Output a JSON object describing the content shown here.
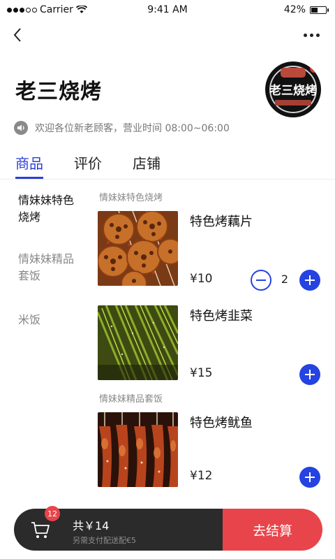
{
  "status_bar": {
    "carrier": "Carrier",
    "time": "9:41 AM",
    "battery": "42%",
    "battery_level": 0.42
  },
  "shop": {
    "name": "老三烧烤",
    "logo_text": "老三烧烤",
    "notice": "欢迎各位新老顾客，营业时间 08:00~06:00"
  },
  "tabs": [
    {
      "label": "商品",
      "active": true
    },
    {
      "label": "评价",
      "active": false
    },
    {
      "label": "店铺",
      "active": false
    }
  ],
  "categories": [
    {
      "label": "情妹妹特色烧烤",
      "active": true
    },
    {
      "label": "情妹妹精品套饭",
      "active": false
    },
    {
      "label": "米饭",
      "active": false
    }
  ],
  "sections": [
    {
      "title": "情妹妹特色烧烤"
    },
    {
      "title": "情妹妹精品套饭"
    }
  ],
  "products": [
    {
      "name": "特色烤藕片",
      "price": "¥10",
      "quantity": "2",
      "image": "grilled-lotus-root"
    },
    {
      "name": "特色烤韭菜",
      "price": "¥15",
      "quantity": "",
      "image": "grilled-chives"
    },
    {
      "name": "特色烤鱿鱼",
      "price": "¥12",
      "quantity": "",
      "image": "grilled-squid"
    }
  ],
  "cart": {
    "badge_count": "12",
    "total": "共￥14",
    "delivery_note": "另需支付配送配€5",
    "checkout_label": "去结算"
  },
  "colors": {
    "accent": "#2543e0",
    "tab_active": "#2a3fd6",
    "checkout": "#e8444b",
    "cart_bar": "#2b2b2b"
  }
}
